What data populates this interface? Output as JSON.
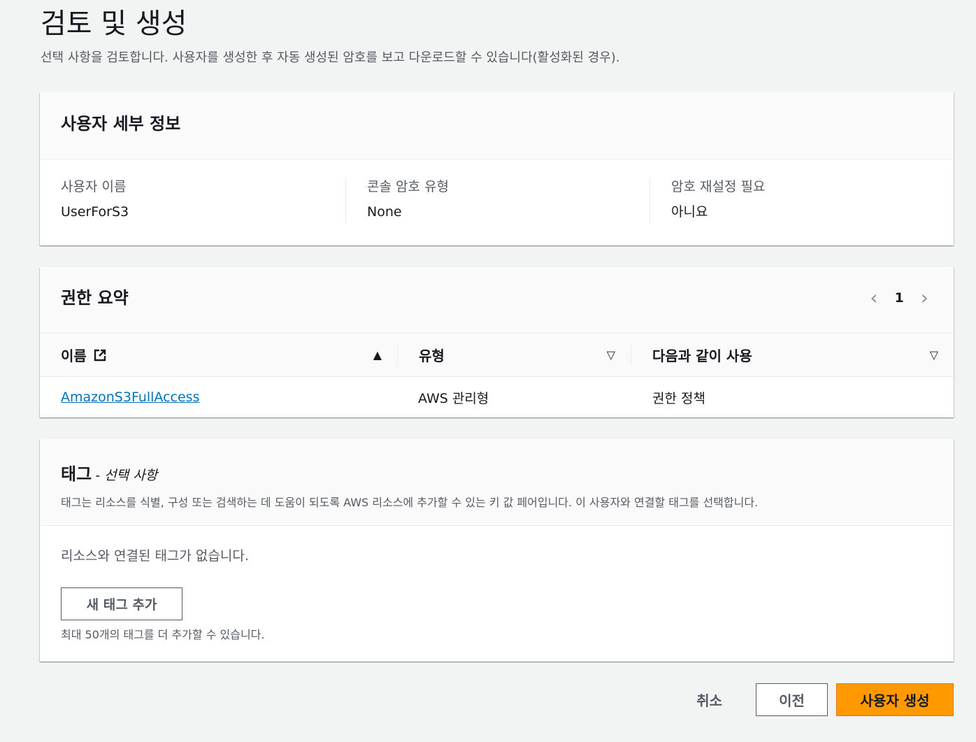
{
  "page": {
    "title": "검토 및 생성",
    "description": "선택 사항을 검토합니다. 사용자를 생성한 후 자동 생성된 암호를 보고 다운로드할 수 있습니다(활성화된 경우)."
  },
  "user_details": {
    "title": "사용자 세부 정보",
    "fields": [
      {
        "label": "사용자 이름",
        "value": "UserForS3"
      },
      {
        "label": "콘솔 암호 유형",
        "value": "None"
      },
      {
        "label": "암호 재설정 필요",
        "value": "아니요"
      }
    ]
  },
  "permissions": {
    "title": "권한 요약",
    "page_number": "1",
    "columns": [
      "이름",
      "유형",
      "다음과 같이 사용"
    ],
    "sort_icons": {
      "name": "▲",
      "type": "▽",
      "used_as": "▽"
    },
    "rows": [
      {
        "name": "AmazonS3FullAccess",
        "type": "AWS 관리형",
        "used_as": "권한 정책"
      }
    ]
  },
  "tags": {
    "title": "태그",
    "optional": "- 선택 사항",
    "description": "태그는 리소스를 식별, 구성 또는 검색하는 데 도움이 되도록 AWS 리소스에 추가할 수 있는 키 값 페어입니다. 이 사용자와 연결할 태그를 선택합니다.",
    "empty_message": "리소스와 연결된 태그가 없습니다.",
    "add_button": "새 태그 추가",
    "hint": "최대 50개의 태그를 더 추가할 수 있습니다."
  },
  "actions": {
    "cancel": "취소",
    "previous": "이전",
    "create": "사용자 생성"
  },
  "colors": {
    "primary": "#ff9900",
    "link": "#0073bb",
    "background": "#f2f3f3"
  }
}
